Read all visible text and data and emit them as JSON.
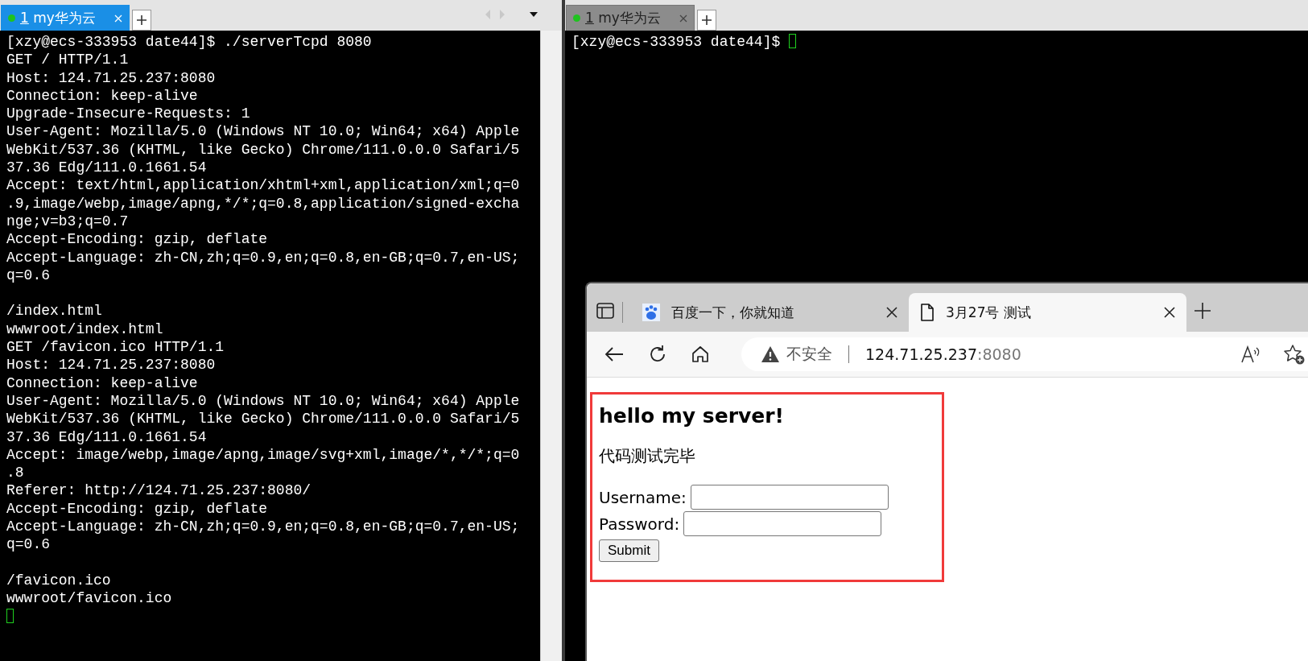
{
  "terminals": [
    {
      "tab": {
        "number": "1",
        "label": "my华为云",
        "selected": true
      },
      "tab_scroll": true,
      "scrollbar": true,
      "cursor_on_new_line": true,
      "blocks": [
        [
          "[xzy@ecs-333953 date44]$ ./serverTcpd 8080",
          "GET / HTTP/1.1",
          "Host: 124.71.25.237:8080",
          "Connection: keep-alive",
          "Upgrade-Insecure-Requests: 1",
          "User-Agent: Mozilla/5.0 (Windows NT 10.0; Win64; x64) Apple",
          "WebKit/537.36 (KHTML, like Gecko) Chrome/111.0.0.0 Safari/5",
          "37.36 Edg/111.0.1661.54",
          "Accept: text/html,application/xhtml+xml,application/xml;q=0",
          ".9,image/webp,image/apng,*/*;q=0.8,application/signed-excha",
          "nge;v=b3;q=0.7",
          "Accept-Encoding: gzip, deflate",
          "Accept-Language: zh-CN,zh;q=0.9,en;q=0.8,en-GB;q=0.7,en-US;",
          "q=0.6"
        ],
        [
          "/index.html",
          "wwwroot/index.html",
          "GET /favicon.ico HTTP/1.1",
          "Host: 124.71.25.237:8080",
          "Connection: keep-alive",
          "User-Agent: Mozilla/5.0 (Windows NT 10.0; Win64; x64) Apple",
          "WebKit/537.36 (KHTML, like Gecko) Chrome/111.0.0.0 Safari/5",
          "37.36 Edg/111.0.1661.54",
          "Accept: image/webp,image/apng,image/svg+xml,image/*,*/*;q=0",
          ".8",
          "Referer: http://124.71.25.237:8080/",
          "Accept-Encoding: gzip, deflate",
          "Accept-Language: zh-CN,zh;q=0.9,en;q=0.8,en-GB;q=0.7,en-US;",
          "q=0.6"
        ],
        [
          "/favicon.ico",
          "wwwroot/favicon.ico"
        ]
      ]
    },
    {
      "tab": {
        "number": "1",
        "label": "my华为云",
        "selected": false
      },
      "tab_scroll": false,
      "scrollbar": false,
      "cursor_on_new_line": false,
      "blocks": [
        [
          "[xzy@ecs-333953 date44]$ "
        ]
      ]
    }
  ],
  "browser": {
    "tabs": [
      {
        "kind": "site",
        "label": "百度一下，你就知道",
        "selected": false
      },
      {
        "kind": "page",
        "label": "3月27号 测试",
        "selected": true
      }
    ],
    "address": {
      "security": "不安全",
      "host": "124.71.25.237",
      "port": ":8080"
    },
    "page": {
      "heading": "hello my server!",
      "text": "代码测试完毕",
      "fields": [
        {
          "label": "Username:"
        },
        {
          "label": "Password:"
        }
      ],
      "submit": "Submit"
    }
  }
}
